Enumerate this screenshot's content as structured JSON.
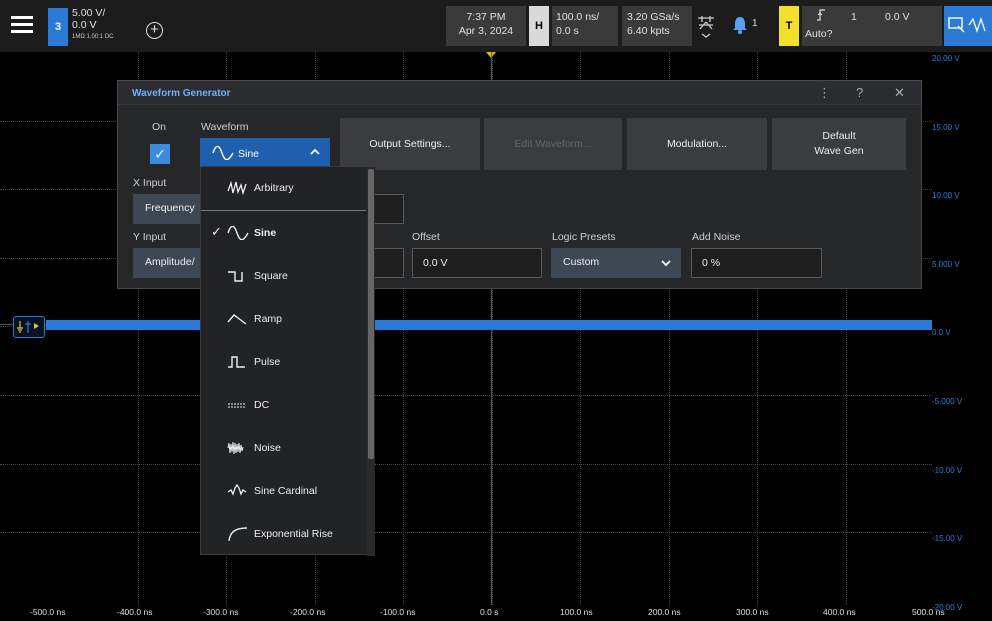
{
  "topbar": {
    "channel": {
      "number": "3",
      "scale": "5.00 V/",
      "offset": "0.0 V",
      "details": "1MΩ  1.00:1  DC"
    },
    "clock": {
      "time": "7:37 PM",
      "date": "Apr 3, 2024"
    },
    "horizontal": {
      "badge": "H",
      "scale": "100.0 ns/",
      "delay": "0.0 s"
    },
    "acquisition": {
      "rate": "3.20 GSa/s",
      "points": "6.40 kpts"
    },
    "notifications": {
      "count": "1"
    },
    "trigger": {
      "badge": "T",
      "source": "1",
      "level": "0.0 V",
      "mode": "Auto?"
    }
  },
  "y_axis": [
    "20.00 V",
    "15.00 V",
    "10.00 V",
    "5.000 V",
    "0.0 V",
    "-5.000 V",
    "-10.00 V",
    "-15.00 V",
    "-20.00 V"
  ],
  "x_axis": [
    "-500.0 ns",
    "-400.0 ns",
    "-300.0 ns",
    "-200.0 ns",
    "-100.0 ns",
    "0.0 s",
    "100.0 ns",
    "200.0 ns",
    "300.0 ns",
    "400.0 ns",
    "500.0 ns"
  ],
  "dialog": {
    "title": "Waveform Generator",
    "on_label": "On",
    "waveform_label": "Waveform",
    "waveform_value": "Sine",
    "buttons": {
      "output_settings": "Output Settings...",
      "edit_waveform": "Edit Waveform...",
      "modulation": "Modulation...",
      "default_line1": "Default",
      "default_line2": "Wave Gen"
    },
    "x_input_label": "X Input",
    "x_input_value": "Frequency",
    "y_input_label": "Y Input",
    "y_input_value": "Amplitude/",
    "offset_label": "Offset",
    "offset_value": "0.0 V",
    "logic_presets_label": "Logic Presets",
    "logic_presets_value": "Custom",
    "add_noise_label": "Add Noise",
    "add_noise_value": "0 %"
  },
  "waveform_options": [
    {
      "label": "Arbitrary",
      "icon": "arbitrary-wave-icon"
    },
    {
      "label": "Sine",
      "icon": "sine-wave-icon",
      "selected": true
    },
    {
      "label": "Square",
      "icon": "square-wave-icon"
    },
    {
      "label": "Ramp",
      "icon": "ramp-wave-icon"
    },
    {
      "label": "Pulse",
      "icon": "pulse-wave-icon"
    },
    {
      "label": "DC",
      "icon": "dc-wave-icon"
    },
    {
      "label": "Noise",
      "icon": "noise-wave-icon"
    },
    {
      "label": "Sine Cardinal",
      "icon": "sine-cardinal-wave-icon"
    },
    {
      "label": "Exponential Rise",
      "icon": "exponential-rise-wave-icon"
    }
  ],
  "colors": {
    "channel": "#2b7bd6",
    "trigger": "#f2e02a",
    "dialog_title": "#6fb0ff"
  }
}
